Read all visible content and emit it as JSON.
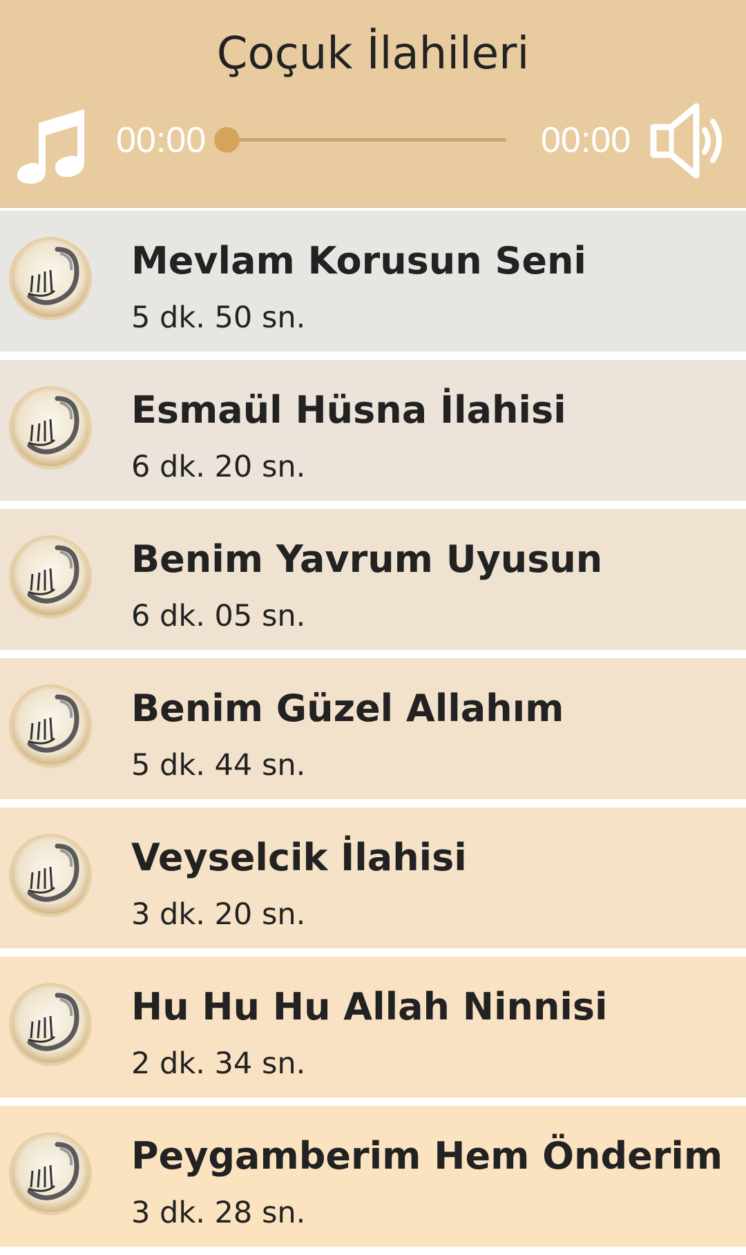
{
  "header": {
    "title": "Çoçuk İlahileri",
    "current_time": "00:00",
    "total_time": "00:00",
    "progress": 0,
    "music_icon": "music-note-icon",
    "volume_icon": "speaker-icon"
  },
  "colors": {
    "header_bg": "#e8cb9f",
    "seek_thumb": "#d6a35a",
    "text": "#222222"
  },
  "list": {
    "items": [
      {
        "title": "Mevlam Korusun Seni",
        "duration": "5 dk. 50 sn.",
        "bg": "#e8e6e2"
      },
      {
        "title": "Esmaül Hüsna İlahisi",
        "duration": "6 dk. 20 sn.",
        "bg": "#ece4da"
      },
      {
        "title": "Benim Yavrum Uyusun",
        "duration": "6 dk. 05 sn.",
        "bg": "#efe2d1"
      },
      {
        "title": "Benim Güzel Allahım",
        "duration": "5 dk. 44 sn.",
        "bg": "#f2e2cc"
      },
      {
        "title": "Veyselcik İlahisi",
        "duration": "3 dk. 20 sn.",
        "bg": "#f5e2c7"
      },
      {
        "title": "Hu Hu Hu Allah Ninnisi",
        "duration": "2 dk. 34 sn.",
        "bg": "#f8e2c3"
      },
      {
        "title": "Peygamberim Hem Önderim",
        "duration": "3 dk. 28 sn.",
        "bg": "#fbe3c0"
      }
    ]
  }
}
